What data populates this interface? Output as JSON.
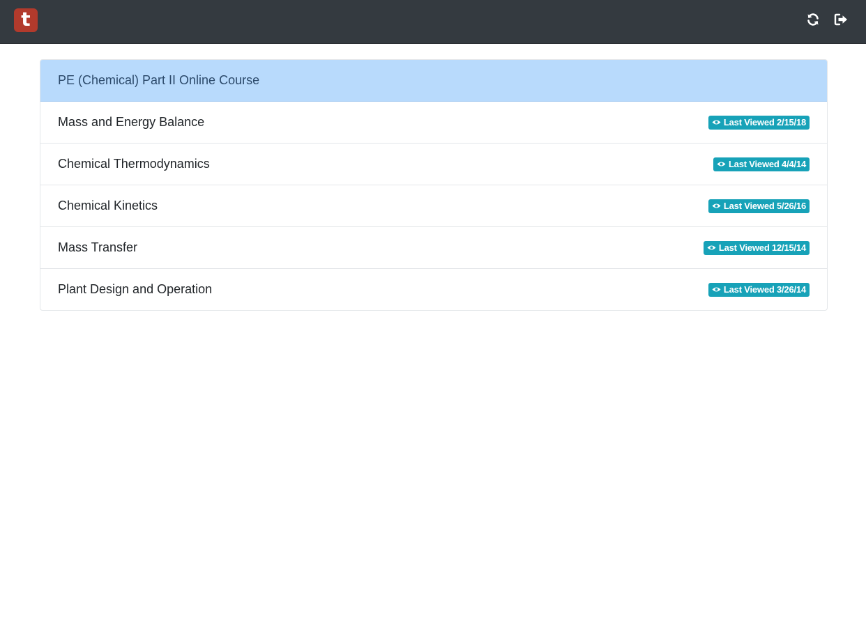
{
  "app": {
    "logo_letter": "t",
    "accent": "#b23a2c",
    "topbar_color": "#343a40",
    "actions": [
      {
        "icon": "refresh-icon"
      },
      {
        "icon": "logout-icon"
      }
    ]
  },
  "course": {
    "title": "PE (Chemical) Part II Online Course",
    "header_color": "#b8dafc",
    "modules": [
      {
        "name": "Mass and Energy Balance",
        "badge": "Last Viewed 2/15/18",
        "badge_icon": "eye-icon"
      },
      {
        "name": "Chemical Thermodynamics",
        "badge": "Last Viewed 4/4/14",
        "badge_icon": "eye-icon"
      },
      {
        "name": "Chemical Kinetics",
        "badge": "Last Viewed 5/26/16",
        "badge_icon": "eye-icon"
      },
      {
        "name": "Mass Transfer",
        "badge": "Last Viewed 12/15/14",
        "badge_icon": "eye-icon"
      },
      {
        "name": "Plant Design and Operation",
        "badge": "Last Viewed 3/26/14",
        "badge_icon": "eye-icon"
      }
    ],
    "badge_color": "#17a2b8"
  }
}
